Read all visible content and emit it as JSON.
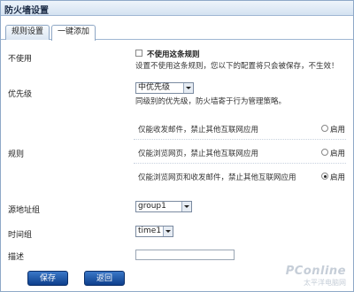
{
  "window": {
    "title": "防火墙设置"
  },
  "tabs": [
    {
      "label": "规则设置",
      "active": false
    },
    {
      "label": "一键添加",
      "active": true
    }
  ],
  "disable": {
    "label": "不使用",
    "checkbox_label": "不使用这条规则",
    "checked": false,
    "note": "设置不使用这条规则，您以下的配置将只会被保存，不生效！"
  },
  "priority": {
    "label": "优先级",
    "selected": "中优先级",
    "note": "同级别的优先级，防火墙寄于行为管理策略。"
  },
  "rules": {
    "label": "规则",
    "items": [
      {
        "text": "仅能收发邮件，禁止其他互联网应用",
        "enable_label": "启用",
        "selected": false
      },
      {
        "text": "仅能浏览网页，禁止其他互联网应用",
        "enable_label": "启用",
        "selected": false
      },
      {
        "text": "仅能浏览网页和收发邮件，禁止其他互联网应用",
        "enable_label": "启用",
        "selected": true
      }
    ]
  },
  "source": {
    "label": "源地址组",
    "selected": "group1"
  },
  "time": {
    "label": "时间组",
    "selected": "time1"
  },
  "description": {
    "label": "描述",
    "value": ""
  },
  "buttons": {
    "save": "保存",
    "back": "返回"
  },
  "watermark": {
    "brand": "PConline",
    "sub": "太平洋电脑网"
  }
}
